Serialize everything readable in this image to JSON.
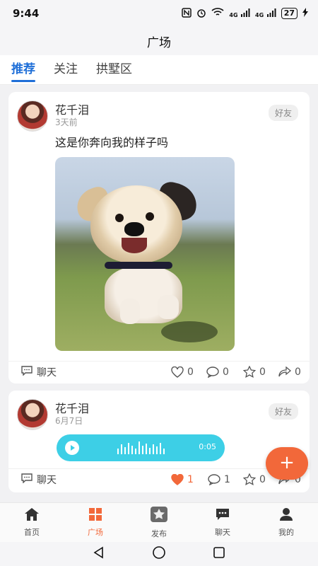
{
  "status_bar": {
    "time": "9:44",
    "battery": "27",
    "signal1": "4G",
    "signal2": "4G"
  },
  "header": {
    "title": "广场"
  },
  "tabs": [
    {
      "label": "推荐",
      "active": true
    },
    {
      "label": "关注",
      "active": false
    },
    {
      "label": "拱墅区",
      "active": false
    }
  ],
  "posts": [
    {
      "author": "花千泪",
      "time": "3天前",
      "badge": "好友",
      "text": "这是你奔向我的样子吗",
      "actions": {
        "chat": "聊天",
        "likes": "0",
        "comments": "0",
        "stars": "0",
        "shares": "0"
      }
    },
    {
      "author": "花千泪",
      "time": "6月7日",
      "badge": "好友",
      "voice_duration": "0:05",
      "actions": {
        "chat": "聊天",
        "likes": "1",
        "comments": "1",
        "stars": "0",
        "shares": "0"
      },
      "liked": true
    }
  ],
  "fab": {
    "label": "+"
  },
  "bottom_nav": [
    {
      "label": "首页",
      "icon": "home-icon",
      "active": false
    },
    {
      "label": "广场",
      "icon": "grid-icon",
      "active": true
    },
    {
      "label": "发布",
      "icon": "publish-icon",
      "active": false
    },
    {
      "label": "聊天",
      "icon": "chat-icon",
      "active": false
    },
    {
      "label": "我的",
      "icon": "profile-icon",
      "active": false
    }
  ],
  "colors": {
    "accent": "#1f6fd8",
    "fab": "#f2683a",
    "voice": "#3dcfe6",
    "like": "#f2683a"
  }
}
